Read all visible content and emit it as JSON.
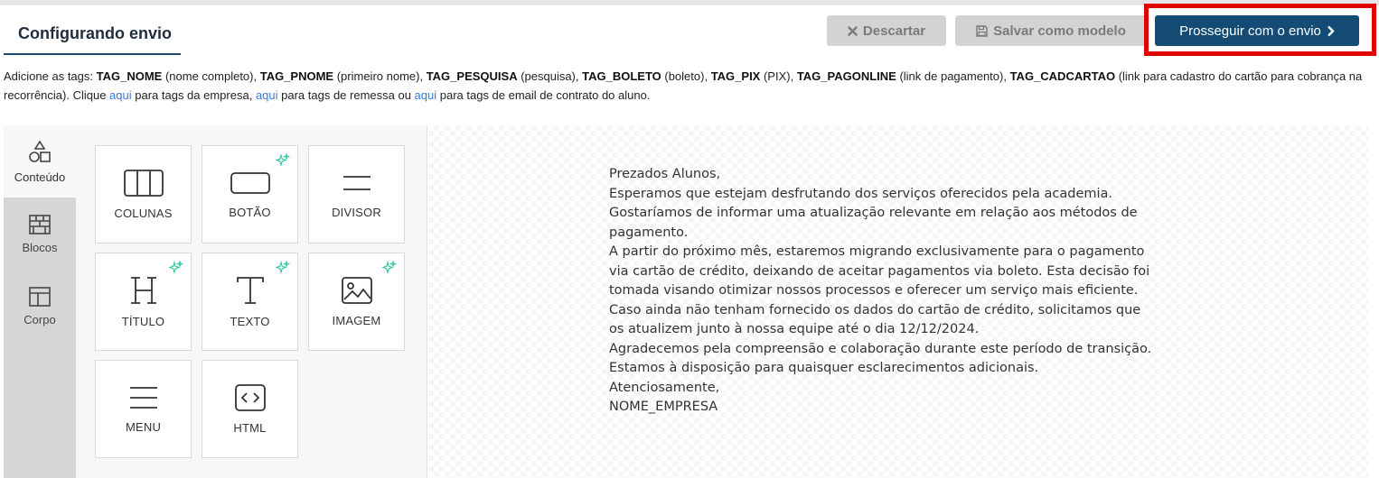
{
  "header": {
    "title": "Configurando envio",
    "discard_label": "Descartar",
    "save_template_label": "Salvar como modelo",
    "proceed_label": "Prosseguir com o envio"
  },
  "tags_info": {
    "intro": "Adicione as tags: ",
    "tags": [
      {
        "name": "TAG_NOME",
        "desc": " (nome completo), "
      },
      {
        "name": "TAG_PNOME",
        "desc": " (primeiro nome), "
      },
      {
        "name": "TAG_PESQUISA",
        "desc": " (pesquisa), "
      },
      {
        "name": "TAG_BOLETO",
        "desc": " (boleto), "
      },
      {
        "name": "TAG_PIX",
        "desc": " (PIX), "
      },
      {
        "name": "TAG_PAGONLINE",
        "desc": " (link de pagamento), "
      },
      {
        "name": "TAG_CADCARTAO",
        "desc": " (link para cadastro do cartão para cobrança na recorrência). Clique "
      }
    ],
    "link1": "aqui",
    "after_link1": " para tags da empresa, ",
    "link2": "aqui",
    "after_link2": " para tags de remessa ou ",
    "link3": "aqui",
    "after_link3": " para tags de email de contrato do aluno."
  },
  "side_tabs": [
    {
      "label": "Conteúdo",
      "icon": "shapes-icon"
    },
    {
      "label": "Blocos",
      "icon": "blocks-icon"
    },
    {
      "label": "Corpo",
      "icon": "layout-icon"
    }
  ],
  "tiles": [
    {
      "label": "COLUNAS",
      "icon": "columns-icon"
    },
    {
      "label": "BOTÃO",
      "icon": "button-icon"
    },
    {
      "label": "DIVISOR",
      "icon": "divider-icon"
    },
    {
      "label": "TÍTULO",
      "icon": "heading-icon"
    },
    {
      "label": "TEXTO",
      "icon": "text-icon"
    },
    {
      "label": "IMAGEM",
      "icon": "image-icon"
    },
    {
      "label": "MENU",
      "icon": "menu-icon"
    },
    {
      "label": "HTML",
      "icon": "code-icon"
    }
  ],
  "email_lines": [
    "Prezados Alunos,",
    "Esperamos que estejam desfrutando dos serviços oferecidos pela academia.",
    "Gostaríamos de informar uma atualização relevante em relação aos métodos de",
    "pagamento.",
    "A partir do próximo mês, estaremos migrando exclusivamente para o pagamento",
    "via cartão de crédito, deixando de aceitar pagamentos via boleto. Esta decisão foi",
    "tomada visando otimizar nossos processos e oferecer um serviço mais eficiente.",
    "Caso ainda não tenham fornecido os dados do cartão de crédito, solicitamos que",
    "os atualizem junto à nossa equipe até o dia 12/12/2024.",
    "Agradecemos pela compreensão e colaboração durante este período de transição.",
    "Estamos à disposição para quaisquer esclarecimentos adicionais.",
    "Atenciosamente,",
    "NOME_EMPRESA"
  ],
  "colors": {
    "primary": "#134b74",
    "highlight": "#e00000",
    "sparkle": "#2ec4a0",
    "link": "#3a7bd5"
  }
}
